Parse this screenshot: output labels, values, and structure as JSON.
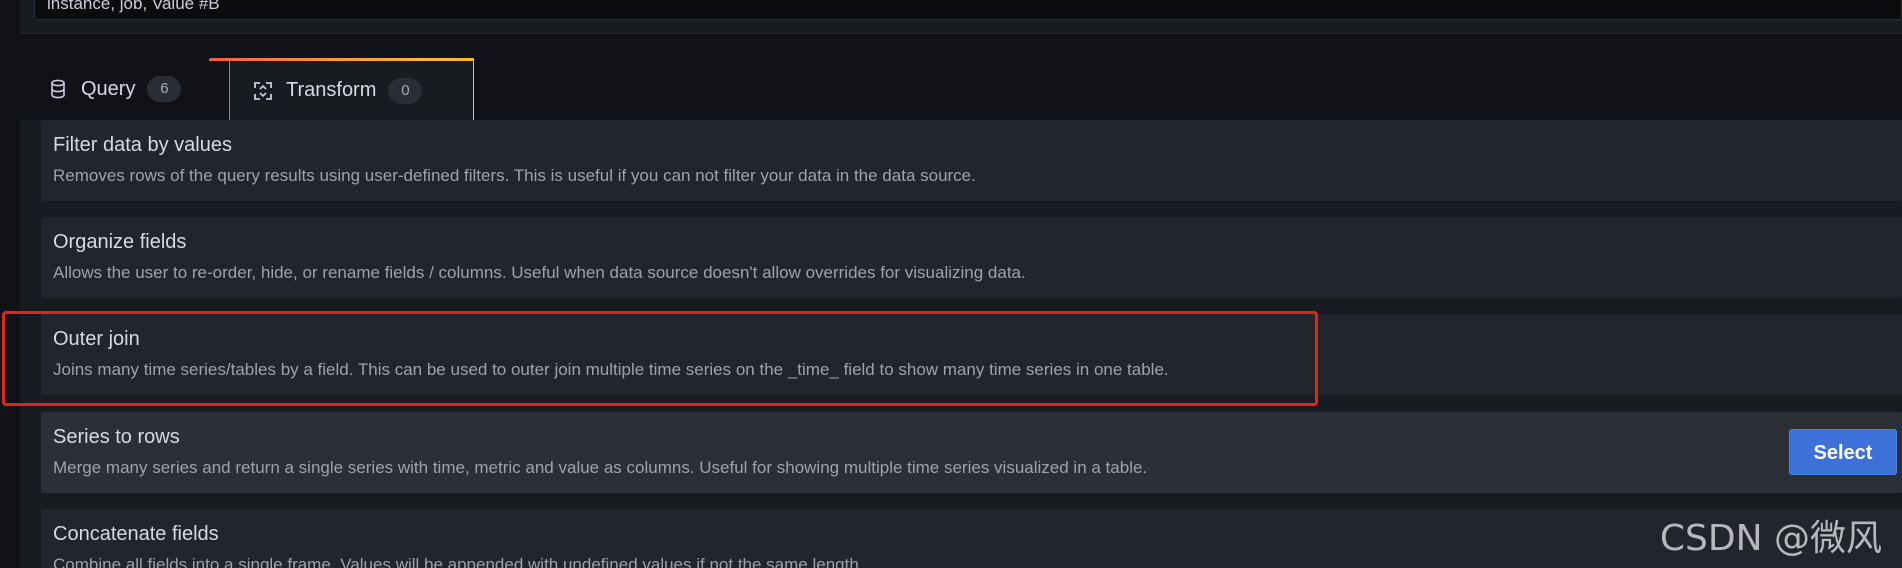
{
  "top_input": {
    "value": "instance, job, Value #B"
  },
  "tabs": [
    {
      "label": "Query",
      "count": "6",
      "icon": "database-icon"
    },
    {
      "label": "Transform",
      "count": "0",
      "icon": "transform-icon"
    }
  ],
  "transformations": [
    {
      "title": "Filter data by values",
      "description": "Removes rows of the query results using user-defined filters. This is useful if you can not filter your data in the data source."
    },
    {
      "title": "Organize fields",
      "description": "Allows the user to re-order, hide, or rename fields / columns. Useful when data source doesn't allow overrides for visualizing data."
    },
    {
      "title": "Outer join",
      "description": "Joins many time series/tables by a field. This can be used to outer join multiple time series on the _time_ field to show many time series in one table."
    },
    {
      "title": "Series to rows",
      "description": "Merge many series and return a single series with time, metric and value as columns. Useful for showing multiple time series visualized in a table.",
      "action_label": "Select"
    },
    {
      "title": "Concatenate fields",
      "description": "Combine all fields into a single frame. Values will be appended with undefined values if not the same length."
    }
  ],
  "watermark": "CSDN @微风",
  "colors": {
    "highlight": "#e3241b",
    "select_button": "#3d71d9",
    "tab_accent": "#ff8833"
  }
}
